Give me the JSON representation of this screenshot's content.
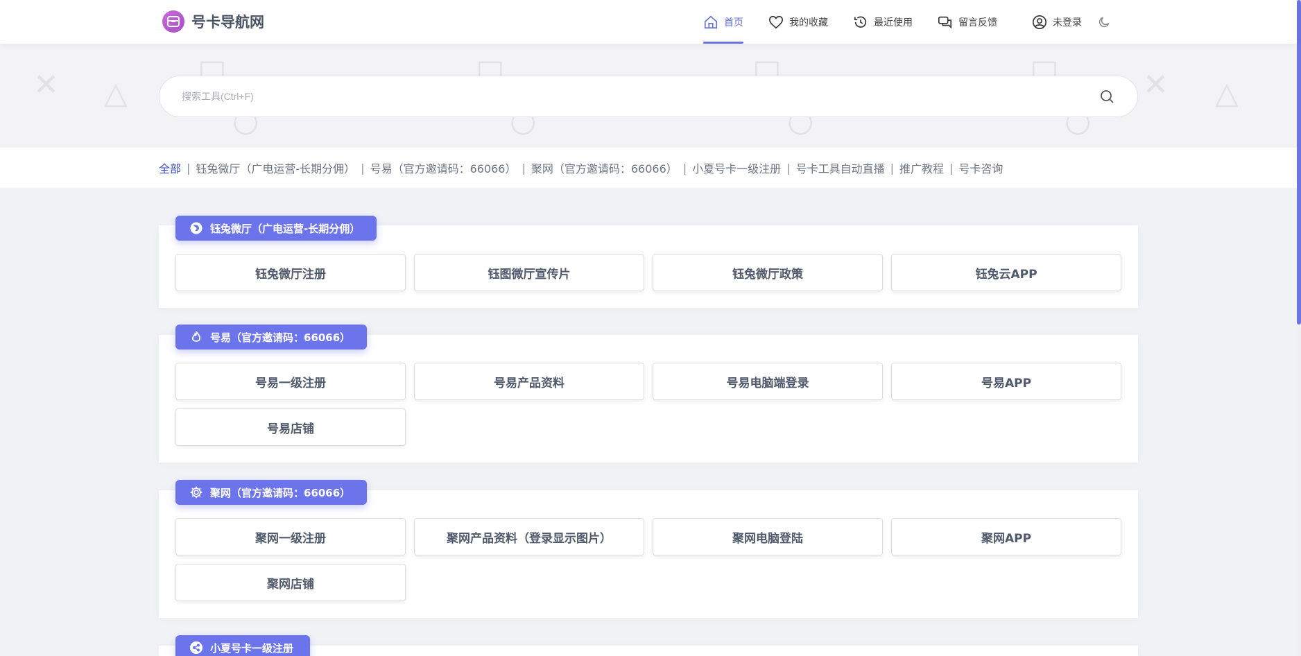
{
  "brand": {
    "name": "号卡导航网"
  },
  "nav": {
    "items": [
      {
        "label": "首页",
        "icon": "home-icon",
        "active": true
      },
      {
        "label": "我的收藏",
        "icon": "heart-icon"
      },
      {
        "label": "最近使用",
        "icon": "history-icon"
      },
      {
        "label": "留言反馈",
        "icon": "chat-icon"
      }
    ],
    "login_label": "未登录"
  },
  "search": {
    "placeholder": "搜索工具(Ctrl+F)"
  },
  "filters": [
    "全部",
    "钰兔微厅（广电运营-长期分佣）",
    "号易（官方邀请码：66066）",
    "聚网（官方邀请码：66066）",
    "小夏号卡一级注册",
    "号卡工具自动直播",
    "推广教程",
    "号卡咨询"
  ],
  "sections": [
    {
      "title": "钰兔微厅（广电运营-长期分佣）",
      "icon": "firefox-icon",
      "cards": [
        "钰兔微厅注册",
        "钰图微厅宣传片",
        "钰兔微厅政策",
        "钰兔云APP"
      ]
    },
    {
      "title": "号易（官方邀请码：66066）",
      "icon": "flame-icon",
      "cards": [
        "号易一级注册",
        "号易产品资料",
        "号易电脑端登录",
        "号易APP",
        "号易店铺"
      ]
    },
    {
      "title": "聚网（官方邀请码：66066）",
      "icon": "gear-icon",
      "cards": [
        "聚网一级注册",
        "聚网产品资料（登录显示图片）",
        "聚网电脑登陆",
        "聚网APP",
        "聚网店铺"
      ]
    },
    {
      "title": "小夏号卡一级注册",
      "icon": "share-icon",
      "cards": []
    }
  ],
  "colors": {
    "accent": "#6b74ea",
    "active_filter": "#3a4ec8",
    "logo": "#b65bd1"
  }
}
